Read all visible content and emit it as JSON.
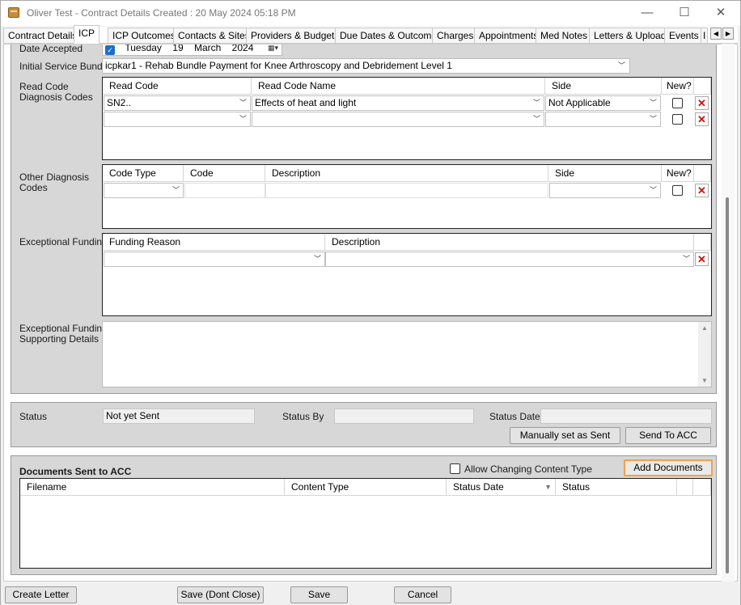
{
  "window": {
    "title": "Oliver Test - Contract Details Created : 20 May 2024 05:18 PM",
    "minimize": "—",
    "maximize": "☐",
    "close": "✕"
  },
  "tabs": [
    {
      "label": "Contract Details"
    },
    {
      "label": "ICP",
      "active": true
    },
    {
      "label": "ICP Outcomes"
    },
    {
      "label": "Contacts & Sites"
    },
    {
      "label": "Providers & Budgets"
    },
    {
      "label": "Due Dates & Outcomes"
    },
    {
      "label": "Charges"
    },
    {
      "label": "Appointments"
    },
    {
      "label": "Med Notes"
    },
    {
      "label": "Letters & Uploads"
    },
    {
      "label": "Events"
    },
    {
      "label": "I"
    }
  ],
  "icp": {
    "date_accepted_label": "Date Accepted",
    "date_day": "Tuesday",
    "date_num": "19",
    "date_month": "March",
    "date_year": "2024",
    "bundle_label": "Initial Service Bundle",
    "bundle_value": "icpkar1 - Rehab Bundle Payment for Knee Arthroscopy and Debridement Level 1",
    "read_code_label_1": "Read Code",
    "read_code_label_2": "Diagnosis Codes",
    "read_code_grid": {
      "headers": [
        "Read Code",
        "Read Code Name",
        "Side",
        "New?"
      ],
      "rows": [
        {
          "code": "SN2..",
          "name": "Effects of heat and light",
          "side": "Not Applicable"
        },
        {
          "code": "",
          "name": "",
          "side": ""
        }
      ]
    },
    "other_diag_label_1": "Other Diagnosis",
    "other_diag_label_2": "Codes",
    "other_diag_grid": {
      "headers": [
        "Code Type",
        "Code",
        "Description",
        "Side",
        "New?"
      ]
    },
    "exc_funding_label": "Exceptional Funding",
    "exc_funding_grid": {
      "headers": [
        "Funding Reason",
        "Description"
      ]
    },
    "exc_support_label_1": "Exceptional Funding",
    "exc_support_label_2": "Supporting Details"
  },
  "status": {
    "status_label": "Status",
    "status_value": "Not yet Sent",
    "status_by_label": "Status By",
    "status_by_value": "",
    "status_date_label": "Status Date",
    "status_date_value": "",
    "manual_button": "Manually set as Sent",
    "send_button": "Send To ACC"
  },
  "documents": {
    "title": "Documents Sent to ACC",
    "allow_changing_label": "Allow Changing Content Type",
    "add_button": "Add Documents",
    "headers": [
      "Filename",
      "Content Type",
      "Status Date",
      "Status"
    ]
  },
  "footer": {
    "create_letter": "Create Letter",
    "save_dont_close": "Save (Dont Close)",
    "save": "Save",
    "cancel": "Cancel"
  }
}
